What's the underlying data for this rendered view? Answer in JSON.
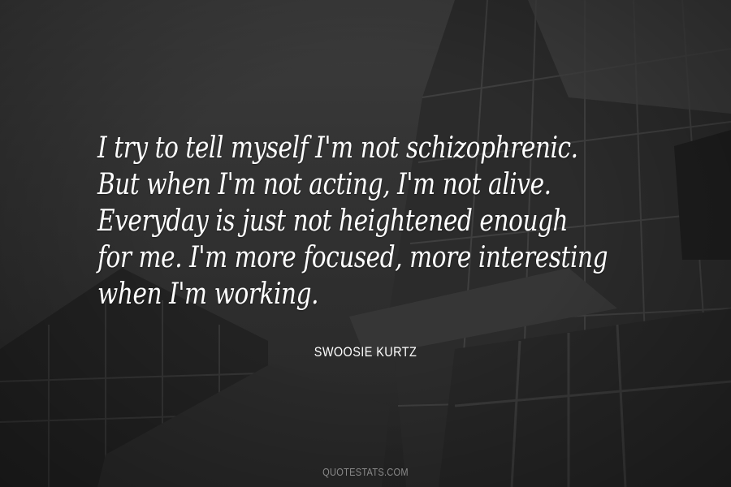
{
  "quote": {
    "lines": [
      "I try to tell myself I'm not schizophrenic.",
      "But when I'm not acting, I'm not alive.",
      "Everyday is just not heightened enough",
      "for me. I'm more focused, more interesting",
      "when I'm working."
    ]
  },
  "author": "SWOOSIE KURTZ",
  "site": "QUOTESTATS.COM",
  "colors": {
    "text": "#ffffff",
    "background": "#2e2e2e",
    "watermark": "#8a8a8a"
  }
}
